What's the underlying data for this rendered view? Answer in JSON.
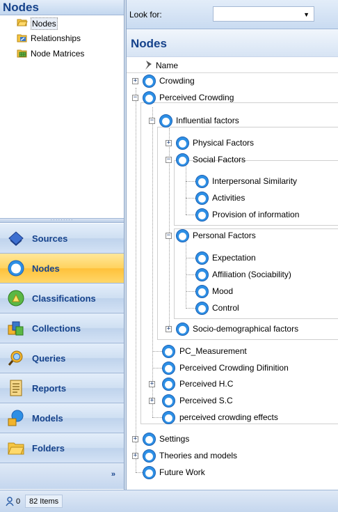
{
  "left_pane": {
    "title": "Nodes",
    "tree_items": [
      {
        "label": "Nodes",
        "icon": "folder-open-icon",
        "selected": true
      },
      {
        "label": "Relationships",
        "icon": "relationships-icon",
        "selected": false
      },
      {
        "label": "Node Matrices",
        "icon": "matrix-icon",
        "selected": false
      }
    ],
    "nav_buttons": [
      {
        "label": "Sources",
        "icon": "sources-icon",
        "active": false
      },
      {
        "label": "Nodes",
        "icon": "node-icon",
        "active": true
      },
      {
        "label": "Classifications",
        "icon": "classifications-icon",
        "active": false
      },
      {
        "label": "Collections",
        "icon": "collections-icon",
        "active": false
      },
      {
        "label": "Queries",
        "icon": "queries-icon",
        "active": false
      },
      {
        "label": "Reports",
        "icon": "reports-icon",
        "active": false
      },
      {
        "label": "Models",
        "icon": "models-icon",
        "active": false
      },
      {
        "label": "Folders",
        "icon": "folders-icon",
        "active": false
      }
    ],
    "overflow_glyph": "»"
  },
  "right_pane": {
    "look_for_label": "Look for:",
    "look_for_value": "",
    "view_title": "Nodes",
    "column_name": "Name"
  },
  "tree": {
    "crowding": "Crowding",
    "perceived_crowding": "Perceived Crowding",
    "influential_factors": "Influential factors",
    "physical_factors": "Physical Factors",
    "social_factors": "Social Factors",
    "interpersonal_similarity": "Interpersonal Similarity",
    "activities": "Activities",
    "provision_of_information": "Provision of information",
    "personal_factors": "Personal Factors",
    "expectation": "Expectation",
    "affiliation": "Affiliation (Sociability)",
    "mood": "Mood",
    "control": "Control",
    "socio_demographical": "Socio-demographical factors",
    "pc_measurement": "PC_Measurement",
    "pc_definition": "Perceived Crowding Difinition",
    "perceived_hc": "Perceived H.C",
    "perceived_sc": "Perceived S.C",
    "pc_effects": "perceived crowding effects",
    "settings": "Settings",
    "theories_models": "Theories and models",
    "future_work": "Future Work"
  },
  "status_bar": {
    "user_count": "0",
    "items_text": "82 Items"
  },
  "colors": {
    "accent": "#15428b",
    "active_nav": "#ffc13a",
    "node_blue": "#2d8fe5"
  }
}
